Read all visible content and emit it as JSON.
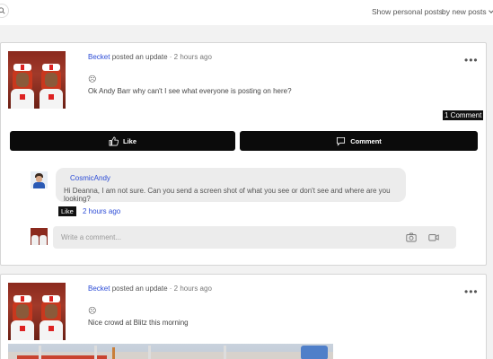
{
  "topbar": {
    "show_filter": "Show personal posts",
    "sort_filter": "by new posts"
  },
  "posts": [
    {
      "author": "Becket",
      "action": " posted an update",
      "time_sep": " · ",
      "time": "2 hours ago",
      "emoji": "☹",
      "text": "Ok Andy Barr why can't I see what everyone is posting on here?",
      "comment_count": "1 Comment",
      "like_label": "Like",
      "comment_label": "Comment",
      "comments": [
        {
          "author": "CosmicAndy",
          "text": "Hi Deanna, I am not sure. Can you send a screen shot of what you see or don't see and where are you looking?",
          "like_label": "Like",
          "time": "2 hours ago"
        }
      ],
      "write_placeholder": "Write a comment..."
    },
    {
      "author": "Becket",
      "action": " posted an update",
      "time_sep": " · ",
      "time": "2 hours ago",
      "emoji": "☹",
      "text": "Nice crowd at Blitz this morning"
    }
  ],
  "icons": {
    "search": "search-icon",
    "more": "more-options-icon",
    "like": "thumbs-up-icon",
    "comment": "comment-icon",
    "camera": "camera-icon",
    "video": "video-icon"
  },
  "colors": {
    "link": "#2b4bd6",
    "button_bg": "#0b0b0b",
    "bubble_bg": "#ececec"
  }
}
